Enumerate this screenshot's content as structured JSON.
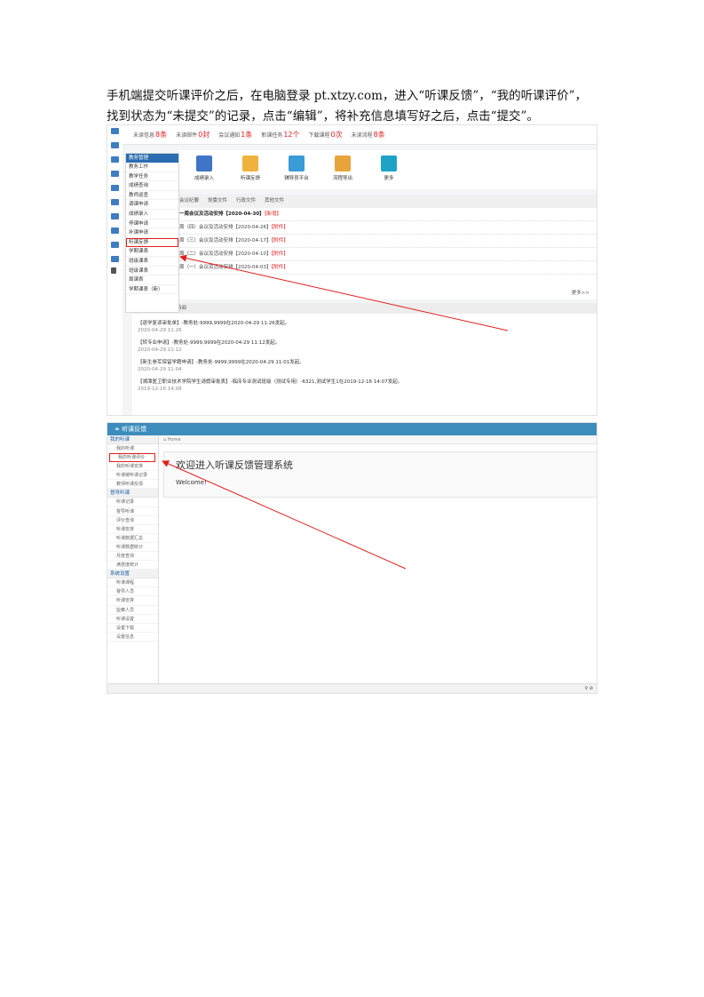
{
  "instruction": {
    "line1": "手机端提交听课评价之后，在电脑登录 pt.xtzy.com，进入“听课反馈”，“我的听课评价”，",
    "line2": "找到状态为“未提交”的记录，点击“编辑”，将补充信息填写好之后，点击“提交”。"
  },
  "shot1": {
    "topbar": [
      {
        "label": "未读信息",
        "count": "8条"
      },
      {
        "label": "未读邮件",
        "count": "0封"
      },
      {
        "label": "会议通知",
        "count": "1条"
      },
      {
        "label": "新课任务",
        "count": "12个"
      },
      {
        "label": "下载课程",
        "count": "0次"
      },
      {
        "label": "未读流程",
        "count": "8条"
      }
    ],
    "menu_head": "教务管理",
    "menu_items": [
      "教务工作",
      "教学任务",
      "成绩查询",
      "教师巡查",
      "调课申请",
      "成绩录入",
      "停课申请",
      "补课申请",
      "听课反馈",
      "学期课表",
      "班级课表",
      "班级课表",
      "周课表",
      "学期课表（新）"
    ],
    "shortcuts": [
      "成绩录入",
      "听课反馈",
      "辅导员平台",
      "流程导出",
      "更多"
    ],
    "tabs": [
      "会议纪要",
      "党委文件",
      "行政文件",
      "其他文件"
    ],
    "news_header": "一周会议及活动安排【2020-04-30】",
    "news_new": "【新增】",
    "news_rows": [
      {
        "text": "周（四）会议及活动安排【2020-04-26】",
        "tag": "【附件】"
      },
      {
        "text": "周（三）会议及活动安排【2020-04-17】",
        "tag": "【附件】"
      },
      {
        "text": "周（二）会议及活动安排【2020-04-10】",
        "tag": "【附件】"
      },
      {
        "text": "周（一）会议及活动安排【2020-04-03】",
        "tag": "【附件】"
      }
    ],
    "more": "更多>>",
    "notice_head": "待阅",
    "notices": [
      {
        "text": "【退学复读审批单】-教务处-9999,9999在2020-04-29 11:26发起。",
        "date": "2020-04-29 11:26"
      },
      {
        "text": "【转专业申请】-教务处-9999,9999在2020-04-29 11:12发起。",
        "date": "2020-04-29 11:12"
      },
      {
        "text": "【新生参军保留学籍申请】-教务处-9999,9999在2020-04-29 11:01发起。",
        "date": "2020-04-29 11:04"
      },
      {
        "text": "【湘潭医卫职业技术学院学生请假审批表】-临床专业测试班级（测试专用）-6321,测试学生1在2019-12-16 14:07发起。",
        "date": "2019-12-16 14:08"
      }
    ]
  },
  "shot2": {
    "title": "听课反馈",
    "crumb": "Home",
    "groups": [
      {
        "name": "我的听课",
        "items": [
          "我的听课",
          "我的听课评价",
          "我的听课安排",
          "听课被听课记录",
          "教师听课反馈"
        ]
      },
      {
        "name": "督导听课",
        "items": [
          "听课记录",
          "督导听课",
          "评价查询",
          "听课安排",
          "听课数据汇总",
          "听课数据统计",
          "月度查询",
          "满意度统计"
        ]
      },
      {
        "name": "系统设置",
        "items": [
          "听课课程",
          "督导人员",
          "听课安排",
          "监察人员",
          "听课设置",
          "设置下载",
          "设置信息"
        ]
      }
    ],
    "badge": "1",
    "welcome_title": "欢迎进入听课反馈管理系统",
    "welcome_sub": "Welcome!",
    "status": "⚲ ⊘"
  },
  "colors": {
    "accent": "#3c8dbc",
    "highlight": "#e02020"
  }
}
